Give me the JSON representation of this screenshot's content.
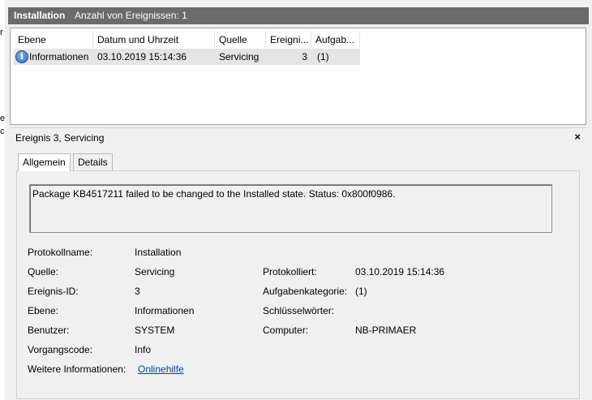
{
  "window": {
    "log_title": "Installation",
    "event_count": "Anzahl von Ereignissen: 1"
  },
  "left_strip": [
    "r",
    "e",
    "c"
  ],
  "event_list": {
    "columns": [
      "Ebene",
      "Datum und Uhrzeit",
      "Quelle",
      "Ereigni...",
      "Aufgab..."
    ],
    "rows": [
      {
        "level_icon": "info-icon",
        "level": "Informationen",
        "datetime": "03.10.2019 15:14:36",
        "source": "Servicing",
        "event_id": "3",
        "task": "(1)"
      }
    ]
  },
  "detail": {
    "title": "Ereignis 3, Servicing",
    "close_glyph": "×",
    "tabs": [
      "Allgemein",
      "Details"
    ],
    "message": "Package KB4517211 failed to be changed to the Installed state. Status: 0x800f0986.",
    "fields": {
      "log_name_label": "Protokollname:",
      "log_name": "Installation",
      "source_label": "Quelle:",
      "source": "Servicing",
      "logged_label": "Protokolliert:",
      "logged": "03.10.2019 15:14:36",
      "event_id_label": "Ereignis-ID:",
      "event_id": "3",
      "task_label": "Aufgabenkategorie:",
      "task": "(1)",
      "level_label": "Ebene:",
      "level": "Informationen",
      "keywords_label": "Schlüsselwörter:",
      "keywords": "",
      "user_label": "Benutzer:",
      "user": "SYSTEM",
      "computer_label": "Computer:",
      "computer": "NB-PRIMAER",
      "opcode_label": "Vorgangscode:",
      "opcode": "Info",
      "more_info_label": "Weitere Informationen:",
      "more_info_link": "Onlinehilfe"
    }
  },
  "colors": {
    "title_bar": "#6b6b6b",
    "selected_row": "#e5e5e5",
    "link": "#0645ad",
    "info_icon": "#2c6cc4"
  }
}
